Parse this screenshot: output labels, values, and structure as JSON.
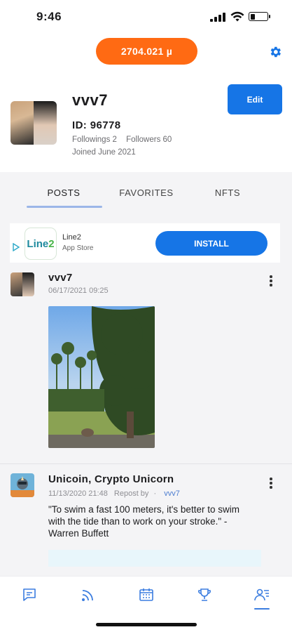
{
  "status_bar": {
    "time": "9:46",
    "battery_level": 0.3
  },
  "header": {
    "balance": "2704.021 µ",
    "settings_icon": "gear-icon",
    "accent": "#ff6a13"
  },
  "profile": {
    "name": "vvv7",
    "id": "ID: 96778",
    "followings": "Followings 2",
    "followers": "Followers 60",
    "joined": "Joined June 2021",
    "edit_label": "Edit"
  },
  "tabs": [
    {
      "label": "POSTS",
      "active": true
    },
    {
      "label": "FAVORITES",
      "active": false
    },
    {
      "label": "NFTS",
      "active": false
    }
  ],
  "ad": {
    "logo_text_a": "Line",
    "logo_text_b": "2",
    "app_name": "Line2",
    "store": "App Store",
    "install_label": "INSTALL"
  },
  "posts": [
    {
      "author": "vvv7",
      "date": "06/17/2021 09:25",
      "has_image": true
    },
    {
      "author": "Unicoin, Crypto Unicorn",
      "date": "11/13/2020 21:48",
      "repost_label": "Repost by",
      "repost_sep": "·",
      "repost_user": "vvv7",
      "text": "\"To swim a fast 100 meters, it's better to swim with the tide than to work on your stroke.\" - Warren Buffett"
    }
  ],
  "bottom_nav": [
    {
      "icon": "chat-icon",
      "active": false
    },
    {
      "icon": "feed-icon",
      "active": false
    },
    {
      "icon": "calendar-icon",
      "active": false
    },
    {
      "icon": "trophy-icon",
      "active": false
    },
    {
      "icon": "profile-list-icon",
      "active": true
    }
  ],
  "colors": {
    "primary": "#1675e6",
    "nav_icon": "#3b7de0"
  }
}
